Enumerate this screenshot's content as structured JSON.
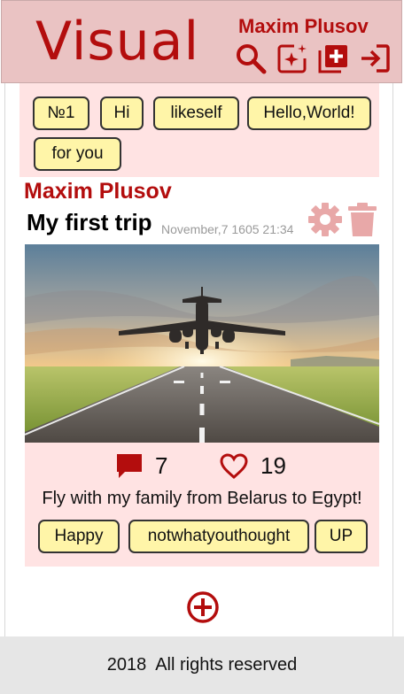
{
  "header": {
    "logo": "Visual",
    "username": "Maxim Plusov",
    "icons": [
      "search-icon",
      "sparkle-add-icon",
      "add-collection-icon",
      "logout-icon"
    ]
  },
  "tags": [
    "№1",
    "Hi",
    "likeself",
    "Hello,World!",
    "for you"
  ],
  "post": {
    "author": "Maxim Plusov",
    "title": "My first trip",
    "date": "November,7 1605 21:34",
    "comments": "7",
    "likes": "19",
    "description": "Fly with my family from Belarus to Egypt!",
    "tags": [
      "Happy",
      "notwhatyouthought",
      "UP"
    ]
  },
  "footer": {
    "text": "2018  All rights reserved"
  },
  "colors": {
    "brand": "#b30d0d",
    "header_bg": "#eac3c3",
    "panel_bg": "#ffe3e3",
    "tag_bg": "#fff5a8",
    "muted_icon": "#e8a8a8"
  }
}
